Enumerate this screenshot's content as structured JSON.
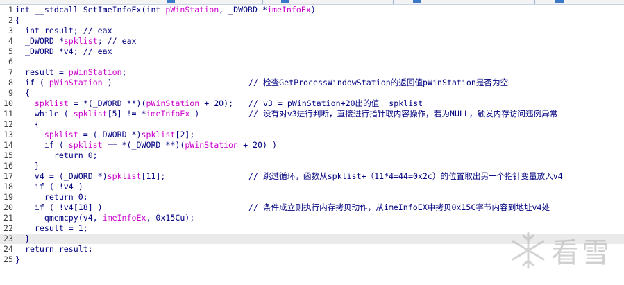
{
  "lines": [
    {
      "n": "1",
      "code": "int __stdcall SetImeInfoEx(int pWinStation, _DWORD *imeInfoEx)",
      "comment": ""
    },
    {
      "n": "2",
      "code": "{",
      "comment": ""
    },
    {
      "n": "3",
      "code": "  int result; // eax",
      "comment": ""
    },
    {
      "n": "4",
      "code": "  _DWORD *spklist; // eax",
      "comment": ""
    },
    {
      "n": "5",
      "code": "  _DWORD *v4; // eax",
      "comment": ""
    },
    {
      "n": "6",
      "code": "",
      "comment": ""
    },
    {
      "n": "7",
      "code": "  result = pWinStation;",
      "comment": ""
    },
    {
      "n": "8",
      "code": "  if ( pWinStation )",
      "comment": "// 检查GetProcessWindowStation的返回值pWinStation是否为空"
    },
    {
      "n": "9",
      "code": "  {",
      "comment": ""
    },
    {
      "n": "10",
      "code": "    spklist = *(_DWORD **)(pWinStation + 20);",
      "comment": "// v3 = pWinStation+20出的值  spklist"
    },
    {
      "n": "11",
      "code": "    while ( spklist[5] != *imeInfoEx )",
      "comment": "// 没有对v3进行判断，直接进行指针取内容操作，若为NULL，触发内存访问违例异常"
    },
    {
      "n": "12",
      "code": "    {",
      "comment": ""
    },
    {
      "n": "13",
      "code": "      spklist = (_DWORD *)spklist[2];",
      "comment": ""
    },
    {
      "n": "14",
      "code": "      if ( spklist == *(_DWORD **)(pWinStation + 20) )",
      "comment": ""
    },
    {
      "n": "15",
      "code": "        return 0;",
      "comment": ""
    },
    {
      "n": "16",
      "code": "    }",
      "comment": ""
    },
    {
      "n": "17",
      "code": "    v4 = (_DWORD *)spklist[11];",
      "comment": "// 跳过循环，函数从spklist+（11*4=44=0x2c）的位置取出另一个指针变量放入v4"
    },
    {
      "n": "18",
      "code": "    if ( !v4 )",
      "comment": ""
    },
    {
      "n": "19",
      "code": "      return 0;",
      "comment": ""
    },
    {
      "n": "20",
      "code": "    if ( !v4[18] )",
      "comment": "// 条件成立则执行内存拷贝动作，从imeInfoEX中拷贝0x15C字节内容到地址v4处"
    },
    {
      "n": "21",
      "code": "      qmemcpy(v4, imeInfoEx, 0x15Cu);",
      "comment": ""
    },
    {
      "n": "22",
      "code": "    result = 1;",
      "comment": ""
    },
    {
      "n": "23",
      "code": "  }",
      "comment": ""
    },
    {
      "n": "24",
      "code": "  return result;",
      "comment": ""
    },
    {
      "n": "25",
      "code": "}",
      "comment": ""
    }
  ],
  "current_line": 23,
  "watermark": {
    "text": "看雪",
    "icon": "snowflake-logo"
  },
  "colors": {
    "code": "#000080",
    "variable": "#cc00cc",
    "line_number": "#404040",
    "highlight": "#eaeaea"
  }
}
